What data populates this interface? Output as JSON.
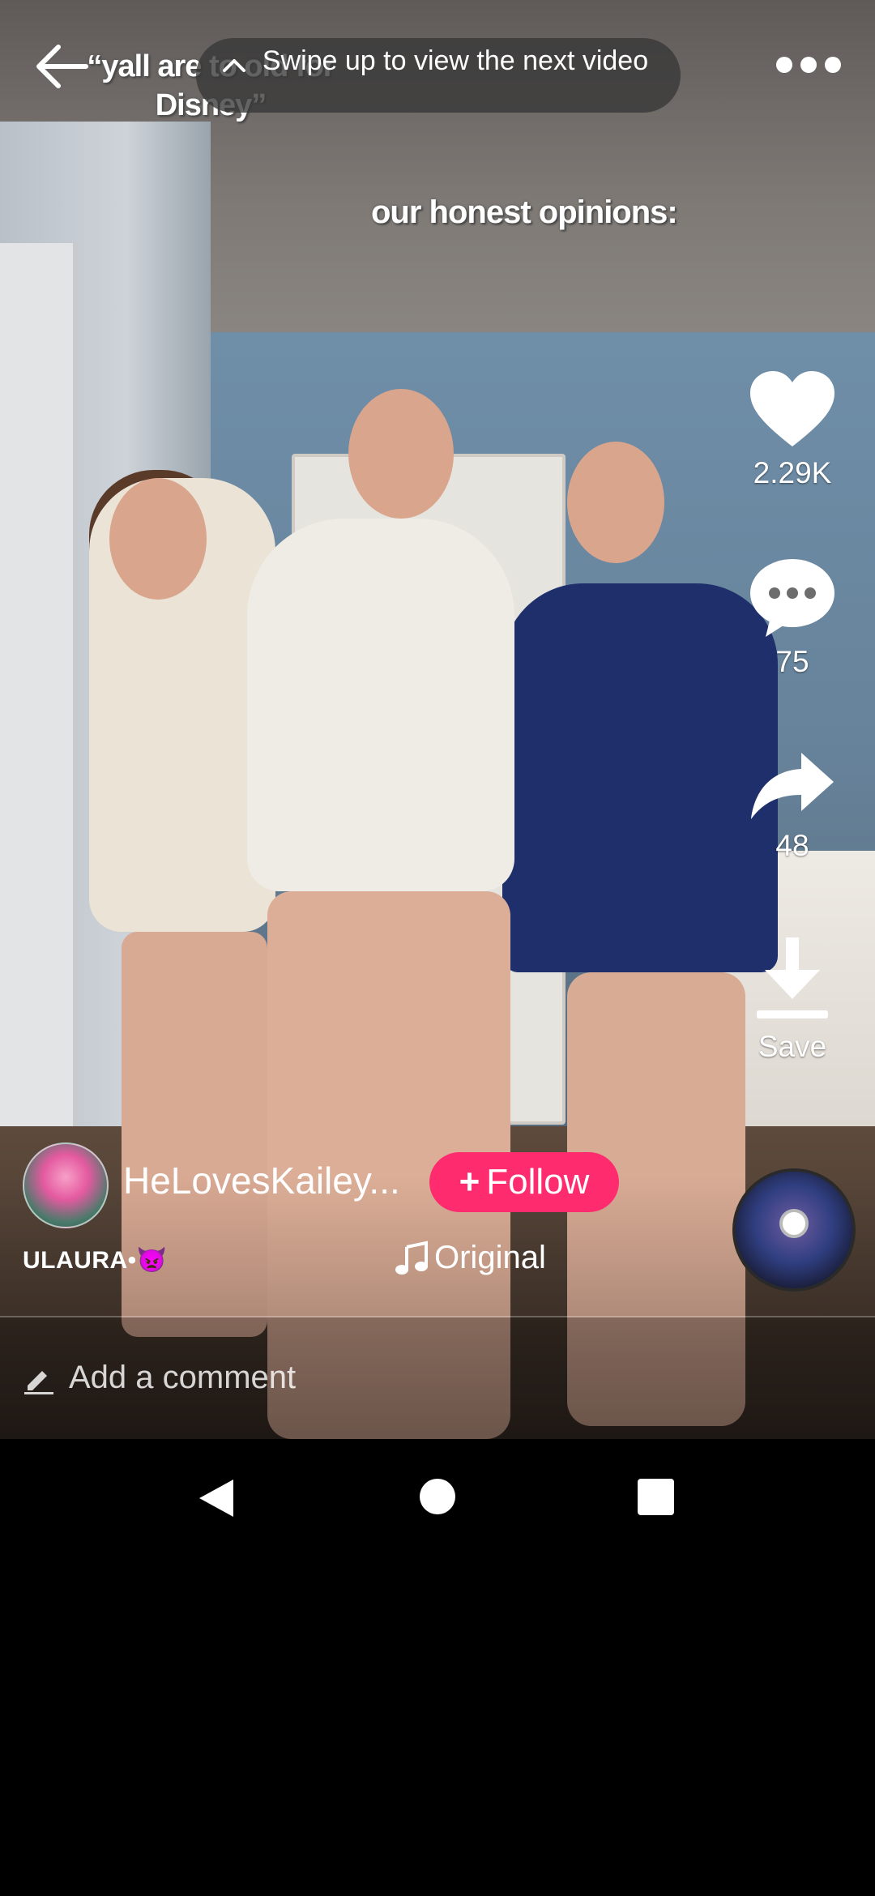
{
  "top_bar": {
    "toast_text": "Swipe up to view the next video"
  },
  "video": {
    "caption_top": "“yall are to old for Disney”",
    "caption_sub": "our honest opinions:"
  },
  "actions": {
    "like_count": "2.29K",
    "comment_count": "75",
    "share_count": "48",
    "save_label": "Save"
  },
  "author": {
    "username": "HeLovesKailey...",
    "follow_label": "Follow",
    "handle": "ULAURA•👿"
  },
  "sound": {
    "label": "Original"
  },
  "comment_input": {
    "placeholder": "Add a comment"
  },
  "colors": {
    "follow_button": "#fe2c6e",
    "background": "#000000"
  },
  "icons": [
    "back-arrow-icon",
    "chevron-up-icon",
    "more-icon",
    "heart-icon",
    "comment-bubble-icon",
    "share-arrow-icon",
    "download-icon",
    "music-note-icon",
    "pencil-icon",
    "nav-back-icon",
    "nav-home-icon",
    "nav-recent-icon"
  ]
}
